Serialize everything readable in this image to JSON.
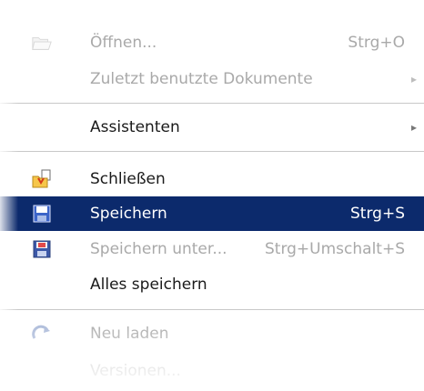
{
  "menu": {
    "items": {
      "open": {
        "label": "Öffnen...",
        "shortcut": "Strg+O",
        "icon": "open-folder-icon",
        "enabled": false
      },
      "recent": {
        "label": "Zuletzt benutzte Dokumente",
        "icon": "submenu-arrow-icon",
        "enabled": false
      },
      "wizards": {
        "label": "Assistenten",
        "icon": "submenu-arrow-icon",
        "enabled": true
      },
      "close": {
        "label": "Schließen",
        "icon": "close-document-icon",
        "enabled": true
      },
      "save": {
        "label": "Speichern",
        "shortcut": "Strg+S",
        "icon": "floppy-save-icon",
        "enabled": true,
        "selected": true
      },
      "save_as": {
        "label": "Speichern unter...",
        "shortcut": "Strg+Umschalt+S",
        "icon": "floppy-save-as-icon",
        "enabled": false
      },
      "save_all": {
        "label": "Alles speichern",
        "enabled": true
      },
      "reload": {
        "label": "Neu laden",
        "icon": "reload-icon",
        "enabled": false
      },
      "versions": {
        "label": "Versionen...",
        "enabled": false
      }
    }
  },
  "colors": {
    "selection": "#0c2a6c",
    "text": "#1a1a1a",
    "disabled_text": "#a9a9a9",
    "separator": "#c8c8c8"
  }
}
